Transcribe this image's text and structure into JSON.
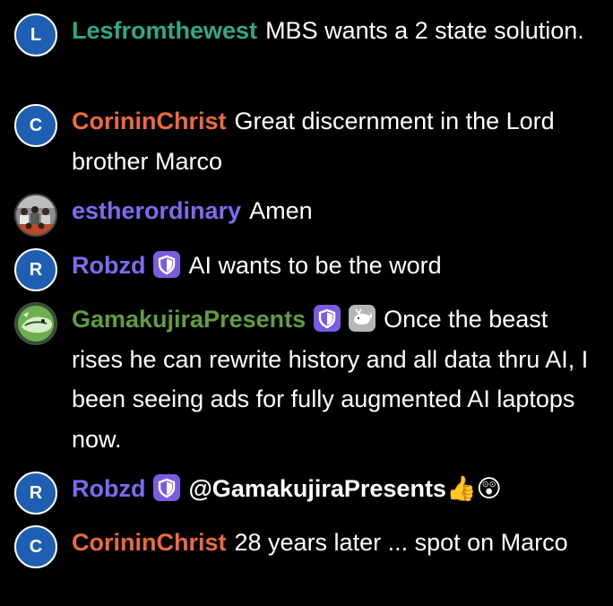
{
  "colors": {
    "background": "#000000",
    "avatar_letter_bg": "#1f5fb3",
    "mod_badge_bg": "#7b5ce0",
    "vip_badge_bg": "#b6b6b6"
  },
  "messages": [
    {
      "avatar": {
        "type": "letter",
        "letter": "L"
      },
      "username": "Lesfromthewest",
      "username_color": "#2fa88a",
      "text": "MBS wants a 2 state solution."
    },
    {
      "avatar": {
        "type": "letter",
        "letter": "C"
      },
      "username": "CorininChrist",
      "username_color": "#ee6a3e",
      "text": "Great discernment in the Lord brother Marco"
    },
    {
      "avatar": {
        "type": "image",
        "icon": "group-photo-avatar"
      },
      "username": "estherordinary",
      "username_color": "#8069f0",
      "text": "Amen"
    },
    {
      "avatar": {
        "type": "letter",
        "letter": "R"
      },
      "username": "Robzd",
      "username_color": "#8069f0",
      "badges": [
        "moderator-shield-icon"
      ],
      "text": "AI wants to be the word"
    },
    {
      "avatar": {
        "type": "image",
        "icon": "green-creature-avatar"
      },
      "username": "GamakujiraPresents",
      "username_color": "#5e9e3e",
      "badges": [
        "moderator-shield-icon",
        "whale-badge-icon"
      ],
      "text": "Once the beast rises he can rewrite history and all data thru AI, I been seeing ads for fully augmented AI laptops now."
    },
    {
      "avatar": {
        "type": "letter",
        "letter": "R"
      },
      "username": "Robzd",
      "username_color": "#8069f0",
      "badges": [
        "moderator-shield-icon"
      ],
      "mention": "@GamakujiraPresents",
      "emoji": "👍😲"
    },
    {
      "avatar": {
        "type": "letter",
        "letter": "C"
      },
      "username": "CorininChrist",
      "username_color": "#ee6a3e",
      "text": "28 years later ... spot on Marco"
    }
  ]
}
